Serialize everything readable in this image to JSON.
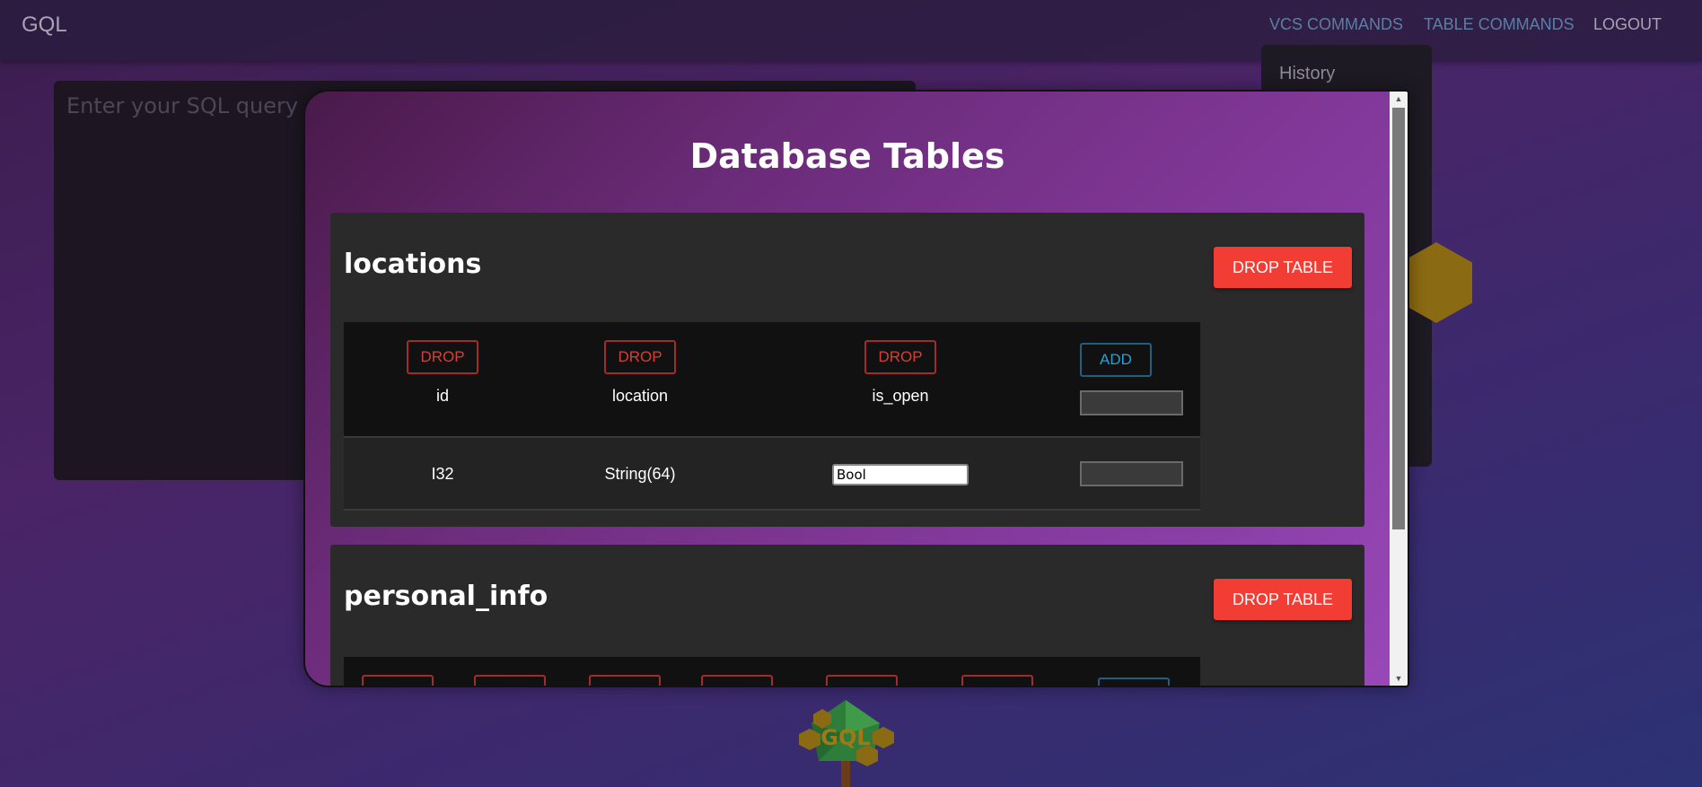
{
  "nav": {
    "brand": "GQL",
    "links": [
      "VCS COMMANDS",
      "TABLE COMMANDS",
      "LOGOUT"
    ]
  },
  "query": {
    "placeholder": "Enter your SQL query"
  },
  "history": {
    "label": "History"
  },
  "modal": {
    "title": "Database Tables",
    "tables": [
      {
        "name": "locations",
        "drop_table_label": "DROP TABLE",
        "columns": [
          {
            "drop_label": "DROP",
            "name": "id",
            "type": "I32"
          },
          {
            "drop_label": "DROP",
            "name": "location",
            "type": "String(64)"
          },
          {
            "drop_label": "DROP",
            "name": "is_open",
            "type": "Bool"
          }
        ],
        "add_label": "ADD"
      },
      {
        "name": "personal_info",
        "drop_table_label": "DROP TABLE",
        "drop_label": "DROP"
      }
    ]
  },
  "logo": {
    "text": "GQL"
  },
  "colors": {
    "danger": "#f13d34",
    "info": "#2a9fd6",
    "nav_link": "#5b7fa4"
  }
}
